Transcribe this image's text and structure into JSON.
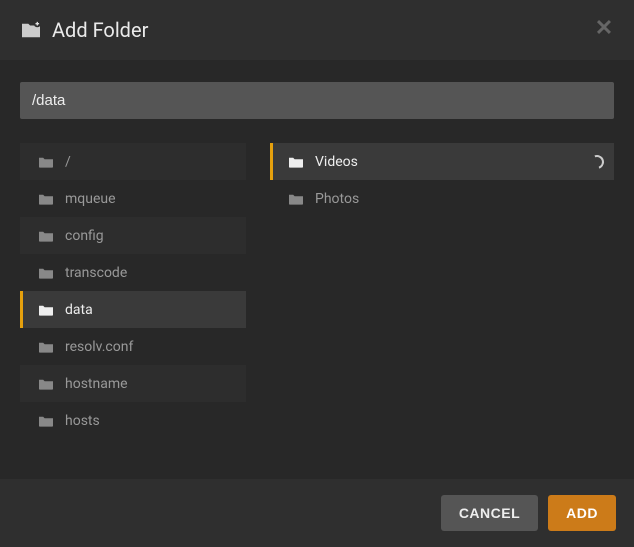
{
  "header": {
    "title": "Add Folder"
  },
  "path": "/data",
  "columns": [
    {
      "items": [
        {
          "label": "/",
          "selected": false,
          "loading": false
        },
        {
          "label": "mqueue",
          "selected": false,
          "loading": false
        },
        {
          "label": "config",
          "selected": false,
          "loading": false
        },
        {
          "label": "transcode",
          "selected": false,
          "loading": false
        },
        {
          "label": "data",
          "selected": true,
          "loading": false
        },
        {
          "label": "resolv.conf",
          "selected": false,
          "loading": false
        },
        {
          "label": "hostname",
          "selected": false,
          "loading": false
        },
        {
          "label": "hosts",
          "selected": false,
          "loading": false
        }
      ]
    },
    {
      "items": [
        {
          "label": "Videos",
          "selected": true,
          "loading": true
        },
        {
          "label": "Photos",
          "selected": false,
          "loading": false
        }
      ]
    }
  ],
  "footer": {
    "cancel": "CANCEL",
    "add": "ADD"
  },
  "colors": {
    "accent": "#cc7b19",
    "selection_border": "#e5a00d"
  }
}
